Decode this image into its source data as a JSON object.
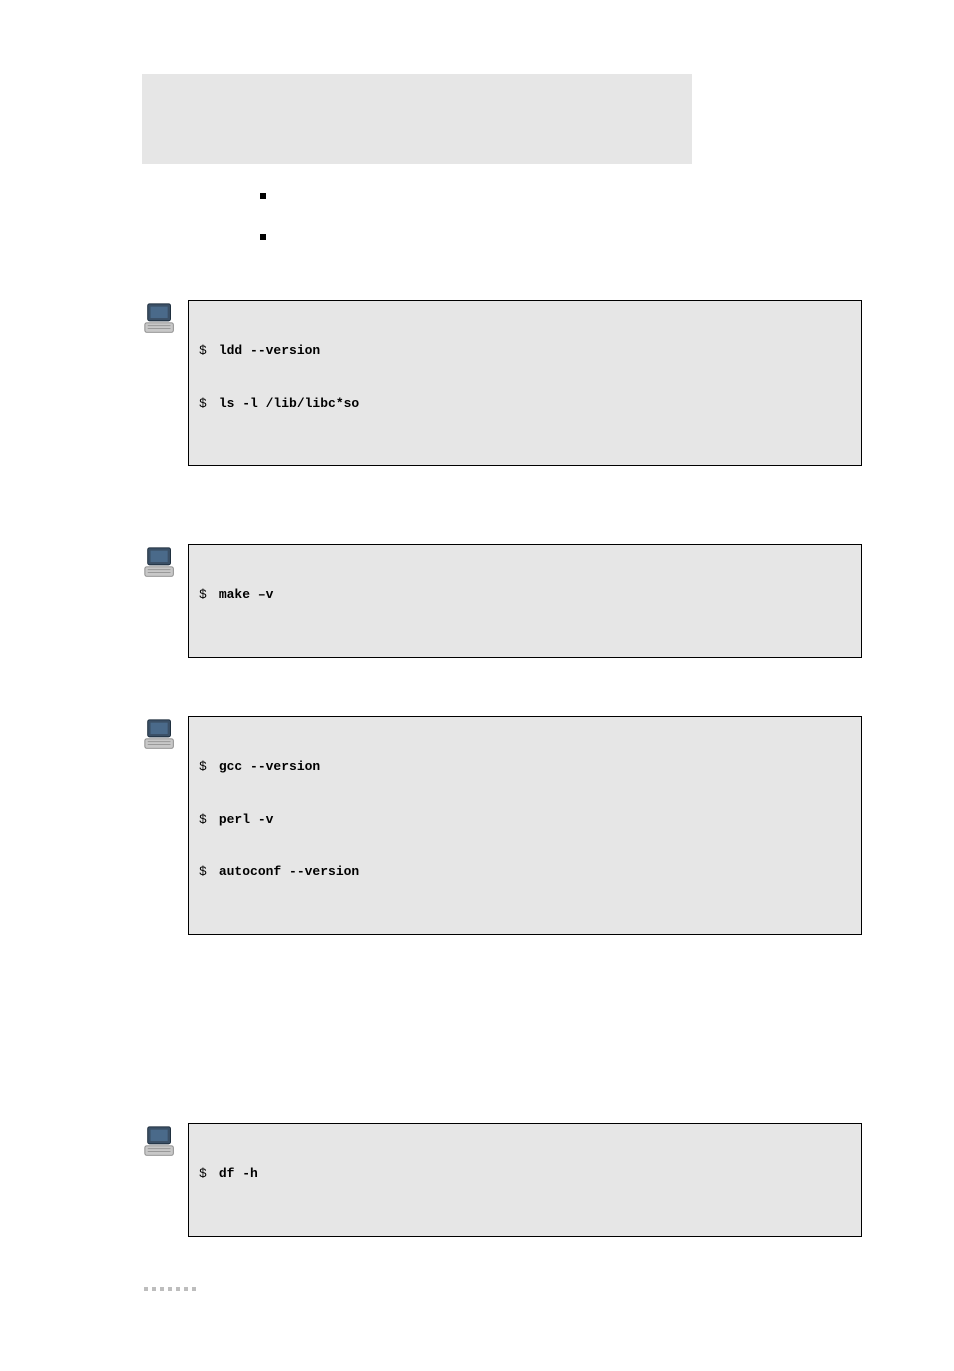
{
  "terminals": [
    {
      "lines": [
        {
          "prompt": "$",
          "command": "ldd --version"
        },
        {
          "prompt": "$",
          "command": "ls -l /lib/libc*so"
        }
      ]
    },
    {
      "lines": [
        {
          "prompt": "$",
          "command": "make –v"
        }
      ]
    },
    {
      "lines": [
        {
          "prompt": "$",
          "command": "gcc --version"
        },
        {
          "prompt": "$",
          "command": "perl -v"
        },
        {
          "prompt": "$",
          "command": "autoconf --version"
        }
      ]
    },
    {
      "lines": [
        {
          "prompt": "$",
          "command": "df -h"
        }
      ]
    }
  ]
}
